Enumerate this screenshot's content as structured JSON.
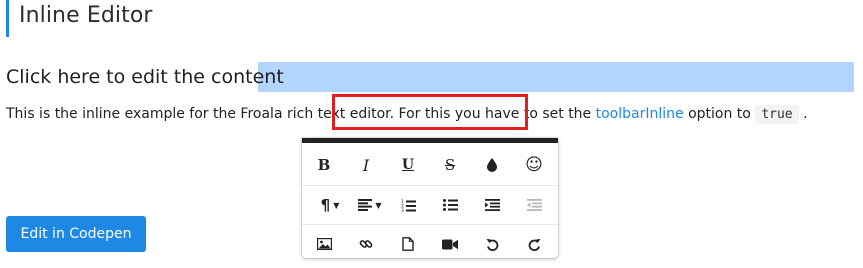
{
  "page": {
    "heading": "Inline Editor",
    "editable_title": "Click here to edit the content",
    "paragraph": {
      "before_link": "This is the inline example for the Froala rich text editor. For this you have to set the ",
      "link_text": "toolbarInline",
      "after_link": " option to ",
      "code": "true",
      "end": " ."
    }
  },
  "toolbar": {
    "row1": [
      {
        "name": "bold-button",
        "glyph": "B"
      },
      {
        "name": "italic-button",
        "glyph": "I"
      },
      {
        "name": "underline-button",
        "glyph": "U"
      },
      {
        "name": "strikethrough-button",
        "glyph": "S"
      },
      {
        "name": "color-button",
        "icon": "droplet-icon"
      },
      {
        "name": "emoticons-button",
        "glyph": "☺"
      }
    ],
    "row2": [
      {
        "name": "paragraph-format-button",
        "glyph": "¶",
        "caret": "▼"
      },
      {
        "name": "align-button",
        "icon": "align-left-icon",
        "caret": "▼"
      },
      {
        "name": "ordered-list-button",
        "icon": "ordered-list-icon"
      },
      {
        "name": "unordered-list-button",
        "icon": "unordered-list-icon"
      },
      {
        "name": "indent-button",
        "icon": "indent-icon"
      },
      {
        "name": "outdent-button",
        "icon": "outdent-icon",
        "disabled": true
      }
    ],
    "row3": [
      {
        "name": "insert-image-button",
        "icon": "image-icon"
      },
      {
        "name": "insert-link-button",
        "icon": "link-icon"
      },
      {
        "name": "insert-file-button",
        "icon": "file-icon"
      },
      {
        "name": "insert-video-button",
        "icon": "video-icon"
      },
      {
        "name": "undo-button",
        "icon": "undo-icon"
      },
      {
        "name": "redo-button",
        "icon": "redo-icon"
      }
    ]
  },
  "buttons": {
    "codepen_label": "Edit in Codepen"
  },
  "colors": {
    "accent": "#1e88e5",
    "selection": "#b3d4fc",
    "annotation": "#e02020",
    "toolbar_top": "#222222"
  }
}
